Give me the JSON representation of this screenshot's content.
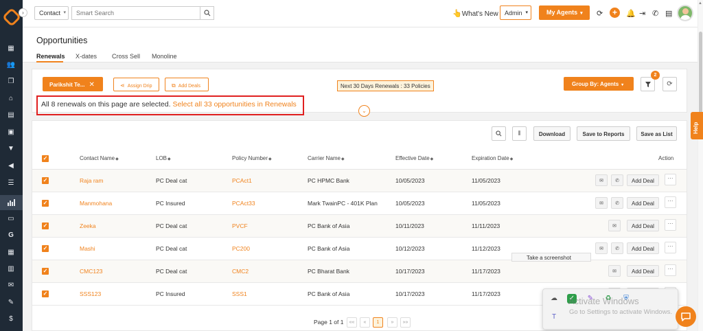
{
  "topbar": {
    "contact_select": "Contact",
    "search_placeholder": "Smart Search",
    "whats_new": "What's New",
    "admin_select": "Admin",
    "my_agents": "My Agents"
  },
  "page": {
    "title": "Opportunities",
    "tabs": [
      {
        "label": "Renewals",
        "active": true
      },
      {
        "label": "X-dates",
        "active": false
      },
      {
        "label": "Cross Sell",
        "active": false
      },
      {
        "label": "Monoline",
        "active": false
      }
    ]
  },
  "filters": {
    "agent_chip": "Parikshit Te...",
    "assign_drip": "Assign Drip",
    "add_deals": "Add Deals",
    "next_30_days": "Next 30 Days Renewals : 33 Policies",
    "group_by": "Group By: Agents",
    "filter_count": "2"
  },
  "selection": {
    "message": "All 8 renewals on this page are selected.",
    "select_all_link": "Select all 33 opportunities in Renewals"
  },
  "table_tools": {
    "download": "Download",
    "save_to_reports": "Save to Reports",
    "save_as_list": "Save as List"
  },
  "table": {
    "columns": [
      "Contact Name",
      "LOB",
      "Policy Number",
      "Carrier Name",
      "Effective Date",
      "Expiration Date",
      "Action"
    ],
    "add_deal_label": "Add Deal",
    "more_label": "···",
    "rows": [
      {
        "contact": "Raja ram",
        "lob": "PC Deal cat",
        "policy": "PCAct1",
        "carrier": "PC HPMC Bank",
        "effective": "10/05/2023",
        "expiration": "11/05/2023",
        "phone": true
      },
      {
        "contact": "Manmohana",
        "lob": "PC Insured",
        "policy": "PCAct33",
        "carrier": "Mark TwainPC - 401K Plan",
        "effective": "10/05/2023",
        "expiration": "11/05/2023",
        "phone": true
      },
      {
        "contact": "Zeeka",
        "lob": "PC Deal cat",
        "policy": "PVCF",
        "carrier": "PC Bank of Asia",
        "effective": "10/11/2023",
        "expiration": "11/11/2023",
        "phone": false
      },
      {
        "contact": "Mashi",
        "lob": "PC Deal cat",
        "policy": "PC200",
        "carrier": "PC Bank of Asia",
        "effective": "10/12/2023",
        "expiration": "11/12/2023",
        "phone": true
      },
      {
        "contact": "CMC123",
        "lob": "PC Deal cat",
        "policy": "CMC2",
        "carrier": "PC Bharat Bank",
        "effective": "10/17/2023",
        "expiration": "11/17/2023",
        "phone": false
      },
      {
        "contact": "SSS123",
        "lob": "PC Insured",
        "policy": "SSS1",
        "carrier": "PC Bank of Asia",
        "effective": "10/17/2023",
        "expiration": "11/17/2023",
        "phone": false
      }
    ]
  },
  "pagination": {
    "label": "Page 1 of 1",
    "first": "««",
    "prev": "«",
    "current": "1",
    "next": "»",
    "last": "»»"
  },
  "overlays": {
    "tooltip": "Take a screenshot",
    "watermark_title": "Activate Windows",
    "watermark_sub": "Go to Settings to activate Windows.",
    "help": "Help"
  },
  "colors": {
    "accent": "#f0821c",
    "sidebar": "#1f2a36",
    "highlight_border": "#e01f1f"
  }
}
